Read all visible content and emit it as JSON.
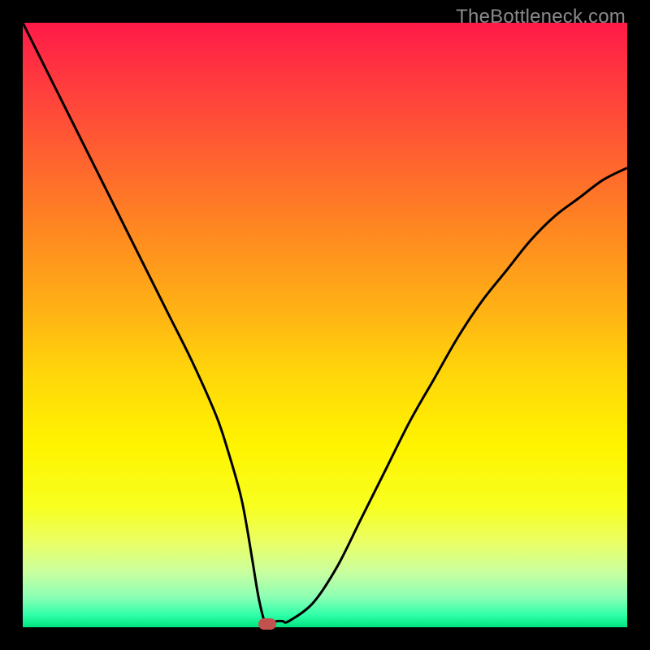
{
  "watermark": "TheBottleneck.com",
  "chart_data": {
    "type": "line",
    "title": "",
    "xlabel": "",
    "ylabel": "",
    "xlim": [
      0,
      100
    ],
    "ylim": [
      0,
      100
    ],
    "series": [
      {
        "name": "bottleneck-curve",
        "x": [
          0,
          4,
          8,
          12,
          16,
          20,
          24,
          28,
          32,
          34,
          36,
          37,
          38,
          39,
          40,
          41,
          42,
          43,
          44,
          48,
          52,
          56,
          60,
          64,
          68,
          72,
          76,
          80,
          84,
          88,
          92,
          96,
          100
        ],
        "values": [
          100,
          92,
          84,
          76,
          68,
          60,
          52,
          44,
          35,
          29,
          22,
          17,
          11,
          5,
          1,
          0.5,
          1,
          1,
          1,
          4,
          10,
          18,
          26,
          34,
          41,
          48,
          54,
          59,
          64,
          68,
          71,
          74,
          76
        ]
      }
    ],
    "marker": {
      "x": 40.5,
      "y": 0.5,
      "color": "#c2524e"
    },
    "gradient_stops": [
      {
        "pct": 0,
        "color": "#ff1a48"
      },
      {
        "pct": 50,
        "color": "#ffd60a"
      },
      {
        "pct": 100,
        "color": "#00e47e"
      }
    ]
  }
}
